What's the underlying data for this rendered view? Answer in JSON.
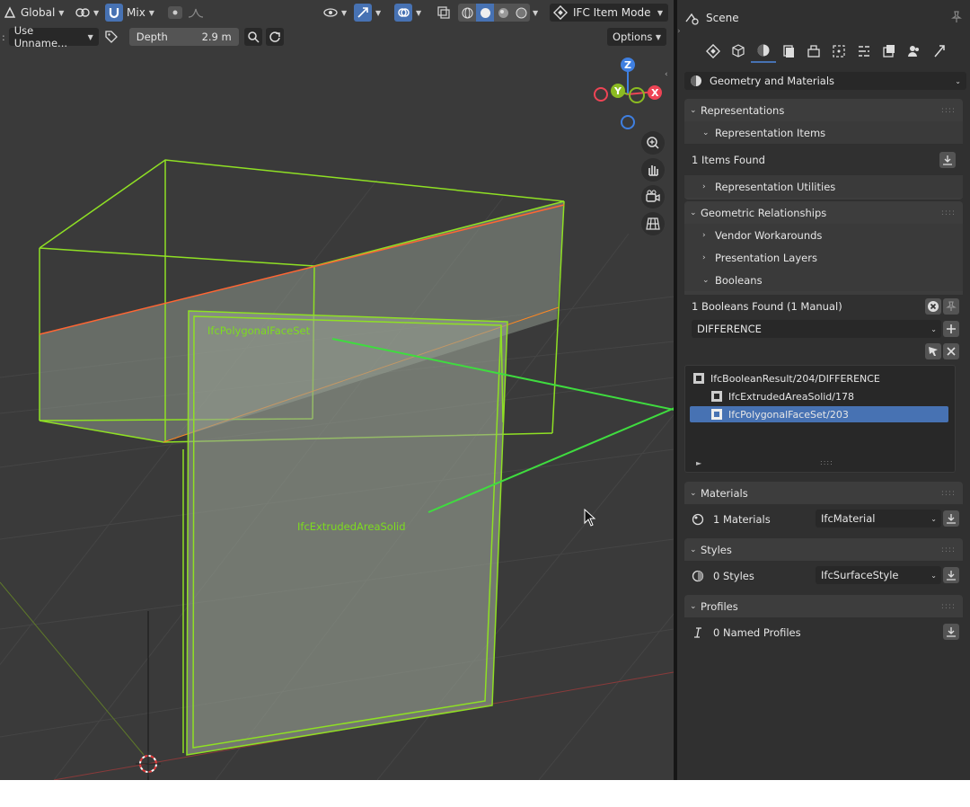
{
  "header": {
    "orientation": "Global",
    "pivot_mode": "Mix",
    "mode": "IFC Item Mode",
    "search_field": "Use Unname...",
    "depth_label": "Depth",
    "depth_value": "2.9 m",
    "options": "Options"
  },
  "gizmo": {
    "x": "X",
    "y": "Y",
    "z": "Z"
  },
  "viewport_labels": {
    "polygonal": "IfcPolygonalFaceSet",
    "extruded": "IfcExtrudedAreaSolid"
  },
  "panel": {
    "title": "Scene",
    "context_dropdown": "Geometry and Materials",
    "representations": {
      "label": "Representations",
      "items_label": "Representation Items",
      "items_found": "1 Items Found",
      "utilities": "Representation Utilities"
    },
    "geometric": {
      "label": "Geometric Relationships",
      "vendor": "Vendor Workarounds",
      "layers": "Presentation Layers",
      "booleans": "Booleans",
      "found": "1 Booleans Found (1 Manual)",
      "operator": "DIFFERENCE",
      "tree": [
        "IfcBooleanResult/204/DIFFERENCE",
        "IfcExtrudedAreaSolid/178",
        "IfcPolygonalFaceSet/203"
      ]
    },
    "materials": {
      "label": "Materials",
      "count": "1 Materials",
      "value": "IfcMaterial"
    },
    "styles": {
      "label": "Styles",
      "count": "0 Styles",
      "value": "IfcSurfaceStyle"
    },
    "profiles": {
      "label": "Profiles",
      "count": "0 Named Profiles"
    }
  },
  "colors": {
    "accent": "#4772b3",
    "wire": "#8fe024",
    "annotation_arrow": "#3fdc3f",
    "axis_x": "#ee4455",
    "axis_y": "#8bbb22",
    "axis_z": "#3f7fe0"
  }
}
